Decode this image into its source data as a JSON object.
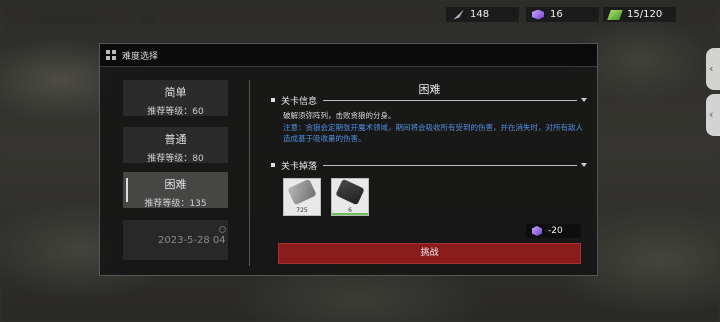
{
  "resources": [
    {
      "icon": "feather-icon",
      "value": "148"
    },
    {
      "icon": "purple-cube-icon",
      "value": "16"
    },
    {
      "icon": "cash-icon",
      "value": "15/120"
    }
  ],
  "panel": {
    "title": "难度选择"
  },
  "difficulties": [
    {
      "name": "简单",
      "level": "推荐等级：60",
      "selected": false
    },
    {
      "name": "普通",
      "level": "推荐等级：80",
      "selected": false
    },
    {
      "name": "困难",
      "level": "推荐等级：135",
      "selected": true
    }
  ],
  "date_text": "2023-5-28 04",
  "stage": {
    "title": "困难",
    "info_label": "关卡信息",
    "description": "破解须弥阵列，击败贪狼的分身。",
    "note": "注意：贪狼会定期张开魔术领域，期间将会吸收所有受到的伤害，并在消失时，对所有敌人造成基于吸收量的伤害。",
    "drops_label": "关卡掉落",
    "drops": [
      {
        "icon": "dogtag-icon",
        "count": "725"
      },
      {
        "icon": "usb-drive-icon",
        "count": "6"
      }
    ]
  },
  "cost": {
    "icon": "purple-cube-icon",
    "value": "-20"
  },
  "challenge_label": "挑战",
  "colors": {
    "accent_red": "#8a1c1c",
    "note_blue": "#4f8fe0",
    "panel_bg": "#161616"
  }
}
